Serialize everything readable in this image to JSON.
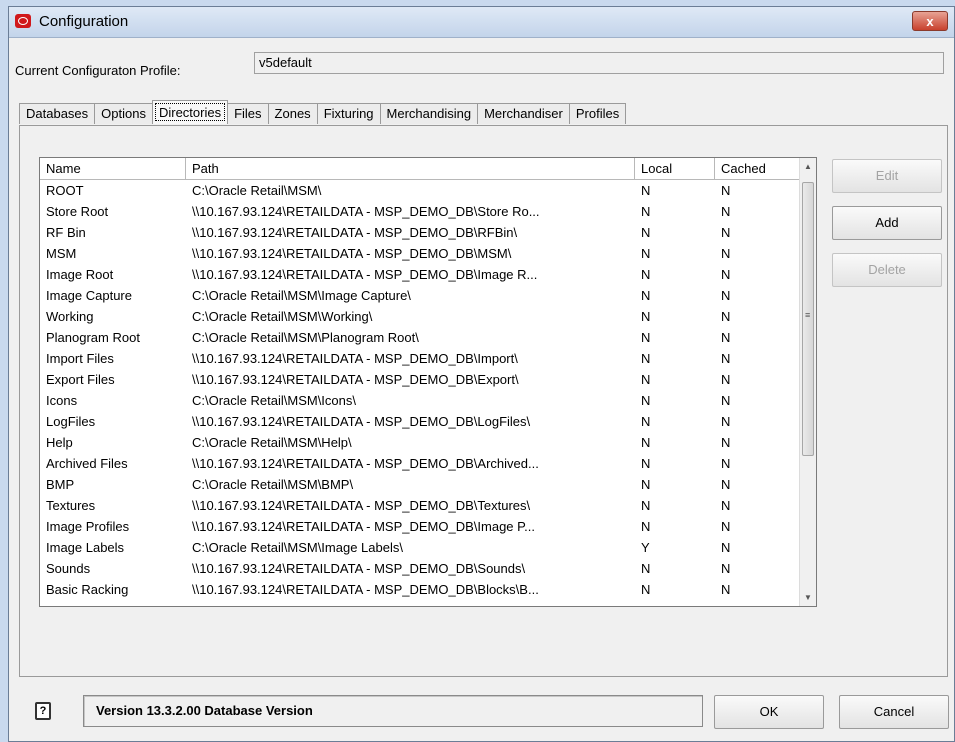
{
  "window": {
    "title": "Configuration",
    "close_symbol": "x"
  },
  "profile": {
    "label": "Current Configuraton Profile:",
    "value": "v5default"
  },
  "tabs": [
    {
      "label": "Databases",
      "active": false
    },
    {
      "label": "Options",
      "active": false
    },
    {
      "label": "Directories",
      "active": true
    },
    {
      "label": "Files",
      "active": false
    },
    {
      "label": "Zones",
      "active": false
    },
    {
      "label": "Fixturing",
      "active": false
    },
    {
      "label": "Merchandising",
      "active": false
    },
    {
      "label": "Merchandiser",
      "active": false
    },
    {
      "label": "Profiles",
      "active": false
    }
  ],
  "table": {
    "columns": [
      "Name",
      "Path",
      "Local",
      "Cached"
    ],
    "rows": [
      [
        "ROOT",
        "C:\\Oracle Retail\\MSM\\",
        "N",
        "N"
      ],
      [
        "Store Root",
        "\\\\10.167.93.124\\RETAILDATA - MSP_DEMO_DB\\Store Ro...",
        "N",
        "N"
      ],
      [
        "RF Bin",
        "\\\\10.167.93.124\\RETAILDATA - MSP_DEMO_DB\\RFBin\\",
        "N",
        "N"
      ],
      [
        "MSM",
        "\\\\10.167.93.124\\RETAILDATA - MSP_DEMO_DB\\MSM\\",
        "N",
        "N"
      ],
      [
        "Image Root",
        "\\\\10.167.93.124\\RETAILDATA - MSP_DEMO_DB\\Image R...",
        "N",
        "N"
      ],
      [
        "Image Capture",
        "C:\\Oracle Retail\\MSM\\Image Capture\\",
        "N",
        "N"
      ],
      [
        "Working",
        "C:\\Oracle Retail\\MSM\\Working\\",
        "N",
        "N"
      ],
      [
        "Planogram Root",
        "C:\\Oracle Retail\\MSM\\Planogram Root\\",
        "N",
        "N"
      ],
      [
        "Import Files",
        "\\\\10.167.93.124\\RETAILDATA - MSP_DEMO_DB\\Import\\",
        "N",
        "N"
      ],
      [
        "Export Files",
        "\\\\10.167.93.124\\RETAILDATA - MSP_DEMO_DB\\Export\\",
        "N",
        "N"
      ],
      [
        "Icons",
        "C:\\Oracle Retail\\MSM\\Icons\\",
        "N",
        "N"
      ],
      [
        "LogFiles",
        "\\\\10.167.93.124\\RETAILDATA - MSP_DEMO_DB\\LogFiles\\",
        "N",
        "N"
      ],
      [
        "Help",
        "C:\\Oracle Retail\\MSM\\Help\\",
        "N",
        "N"
      ],
      [
        "Archived Files",
        "\\\\10.167.93.124\\RETAILDATA - MSP_DEMO_DB\\Archived...",
        "N",
        "N"
      ],
      [
        "BMP",
        "C:\\Oracle Retail\\MSM\\BMP\\",
        "N",
        "N"
      ],
      [
        "Textures",
        "\\\\10.167.93.124\\RETAILDATA - MSP_DEMO_DB\\Textures\\",
        "N",
        "N"
      ],
      [
        "Image Profiles",
        "\\\\10.167.93.124\\RETAILDATA - MSP_DEMO_DB\\Image P...",
        "N",
        "N"
      ],
      [
        "Image Labels",
        "C:\\Oracle Retail\\MSM\\Image Labels\\",
        "Y",
        "N"
      ],
      [
        "Sounds",
        "\\\\10.167.93.124\\RETAILDATA - MSP_DEMO_DB\\Sounds\\",
        "N",
        "N"
      ],
      [
        "Basic Racking",
        "\\\\10.167.93.124\\RETAILDATA - MSP_DEMO_DB\\Blocks\\B...",
        "N",
        "N"
      ]
    ]
  },
  "side_buttons": {
    "edit": "Edit",
    "add": "Add",
    "delete": "Delete"
  },
  "status": {
    "text": "Version 13.3.2.00 Database Version",
    "help_symbol": "?"
  },
  "footer_buttons": {
    "ok": "OK",
    "cancel": "Cancel"
  },
  "icons": {
    "app": "oracle-logo-icon",
    "help": "help-icon",
    "close": "close-icon"
  },
  "colors": {
    "brand": "#d0181b",
    "titlebar": "#c3d4ea",
    "close": "#c8412d"
  }
}
